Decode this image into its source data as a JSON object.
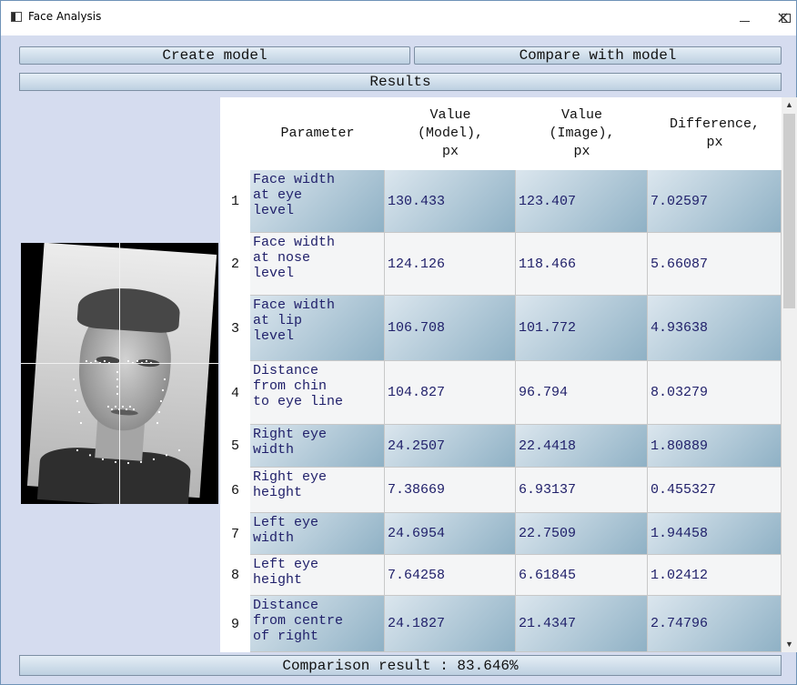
{
  "window": {
    "title": "Face Analysis",
    "controls": {
      "minimize": "–",
      "maximize": "☐",
      "close": "×"
    }
  },
  "toolbar": {
    "create_model": "Create model",
    "compare_with_model": "Compare with model"
  },
  "results_header": "Results",
  "table": {
    "columns": [
      "Parameter",
      "Value (Model), px",
      "Value (Image), px",
      "Difference, px"
    ],
    "header_lines": {
      "parameter": [
        "Parameter"
      ],
      "model": [
        "Value",
        "(Model),",
        "px"
      ],
      "image": [
        "Value",
        "(Image),",
        "px"
      ],
      "difference": [
        "Difference,",
        "px"
      ]
    },
    "rows": [
      {
        "num": "1",
        "param_lines": [
          "Face width",
          "at eye",
          "level"
        ],
        "model": "130.433",
        "image": "123.407",
        "diff": "7.02597",
        "shaded": true
      },
      {
        "num": "2",
        "param_lines": [
          "Face width",
          "at nose",
          "level"
        ],
        "model": "124.126",
        "image": "118.466",
        "diff": "5.66087",
        "shaded": false
      },
      {
        "num": "3",
        "param_lines": [
          "Face width",
          "at lip",
          "level"
        ],
        "model": "106.708",
        "image": "101.772",
        "diff": "4.93638",
        "shaded": true
      },
      {
        "num": "4",
        "param_lines": [
          "Distance",
          "from chin",
          "to eye line"
        ],
        "model": "104.827",
        "image": "96.794",
        "diff": "8.03279",
        "shaded": false
      },
      {
        "num": "5",
        "param_lines": [
          "Right eye",
          "width"
        ],
        "model": "24.2507",
        "image": "22.4418",
        "diff": "1.80889",
        "shaded": true
      },
      {
        "num": "6",
        "param_lines": [
          "Right eye",
          "height"
        ],
        "model": "7.38669",
        "image": "6.93137",
        "diff": "0.455327",
        "shaded": false
      },
      {
        "num": "7",
        "param_lines": [
          "Left eye",
          "width"
        ],
        "model": "24.6954",
        "image": "22.7509",
        "diff": "1.94458",
        "shaded": true
      },
      {
        "num": "8",
        "param_lines": [
          "Left eye",
          "height"
        ],
        "model": "7.64258",
        "image": "6.61845",
        "diff": "1.02412",
        "shaded": false
      },
      {
        "num": "9",
        "param_lines": [
          "Distance",
          "from centre",
          "of right"
        ],
        "model": "24.1827",
        "image": "21.4347",
        "diff": "2.74796",
        "shaded": true
      }
    ]
  },
  "status": {
    "comparison_result": "Comparison result : 83.646%"
  },
  "colors": {
    "window_bg": "#d5dcef",
    "cell_text": "#20206a",
    "shaded_light": "#dbe6ee",
    "shaded_dark": "#8fb1c5"
  }
}
